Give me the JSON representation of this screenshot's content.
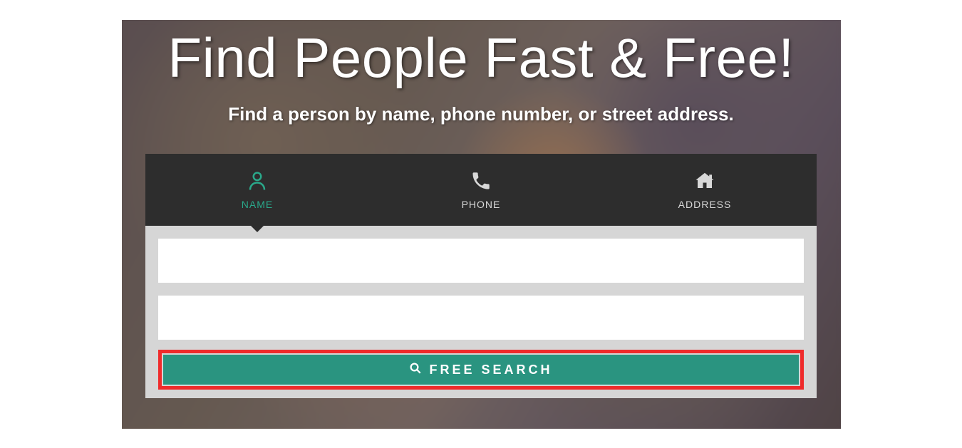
{
  "hero": {
    "title": "Find People Fast & Free!",
    "subtitle": "Find a person by name, phone number, or street address."
  },
  "tabs": {
    "name": {
      "label": "NAME",
      "active": true
    },
    "phone": {
      "label": "PHONE",
      "active": false
    },
    "address": {
      "label": "ADDRESS",
      "active": false
    }
  },
  "form": {
    "input1": {
      "value": "",
      "placeholder": ""
    },
    "input2": {
      "value": "",
      "placeholder": ""
    },
    "button_label": "FREE SEARCH"
  },
  "colors": {
    "accent": "#2aa88a",
    "tab_bg": "#2d2d2d",
    "panel_bg": "#d6d6d6",
    "button_bg": "#2a9480",
    "highlight_border": "#ef2b2b"
  }
}
